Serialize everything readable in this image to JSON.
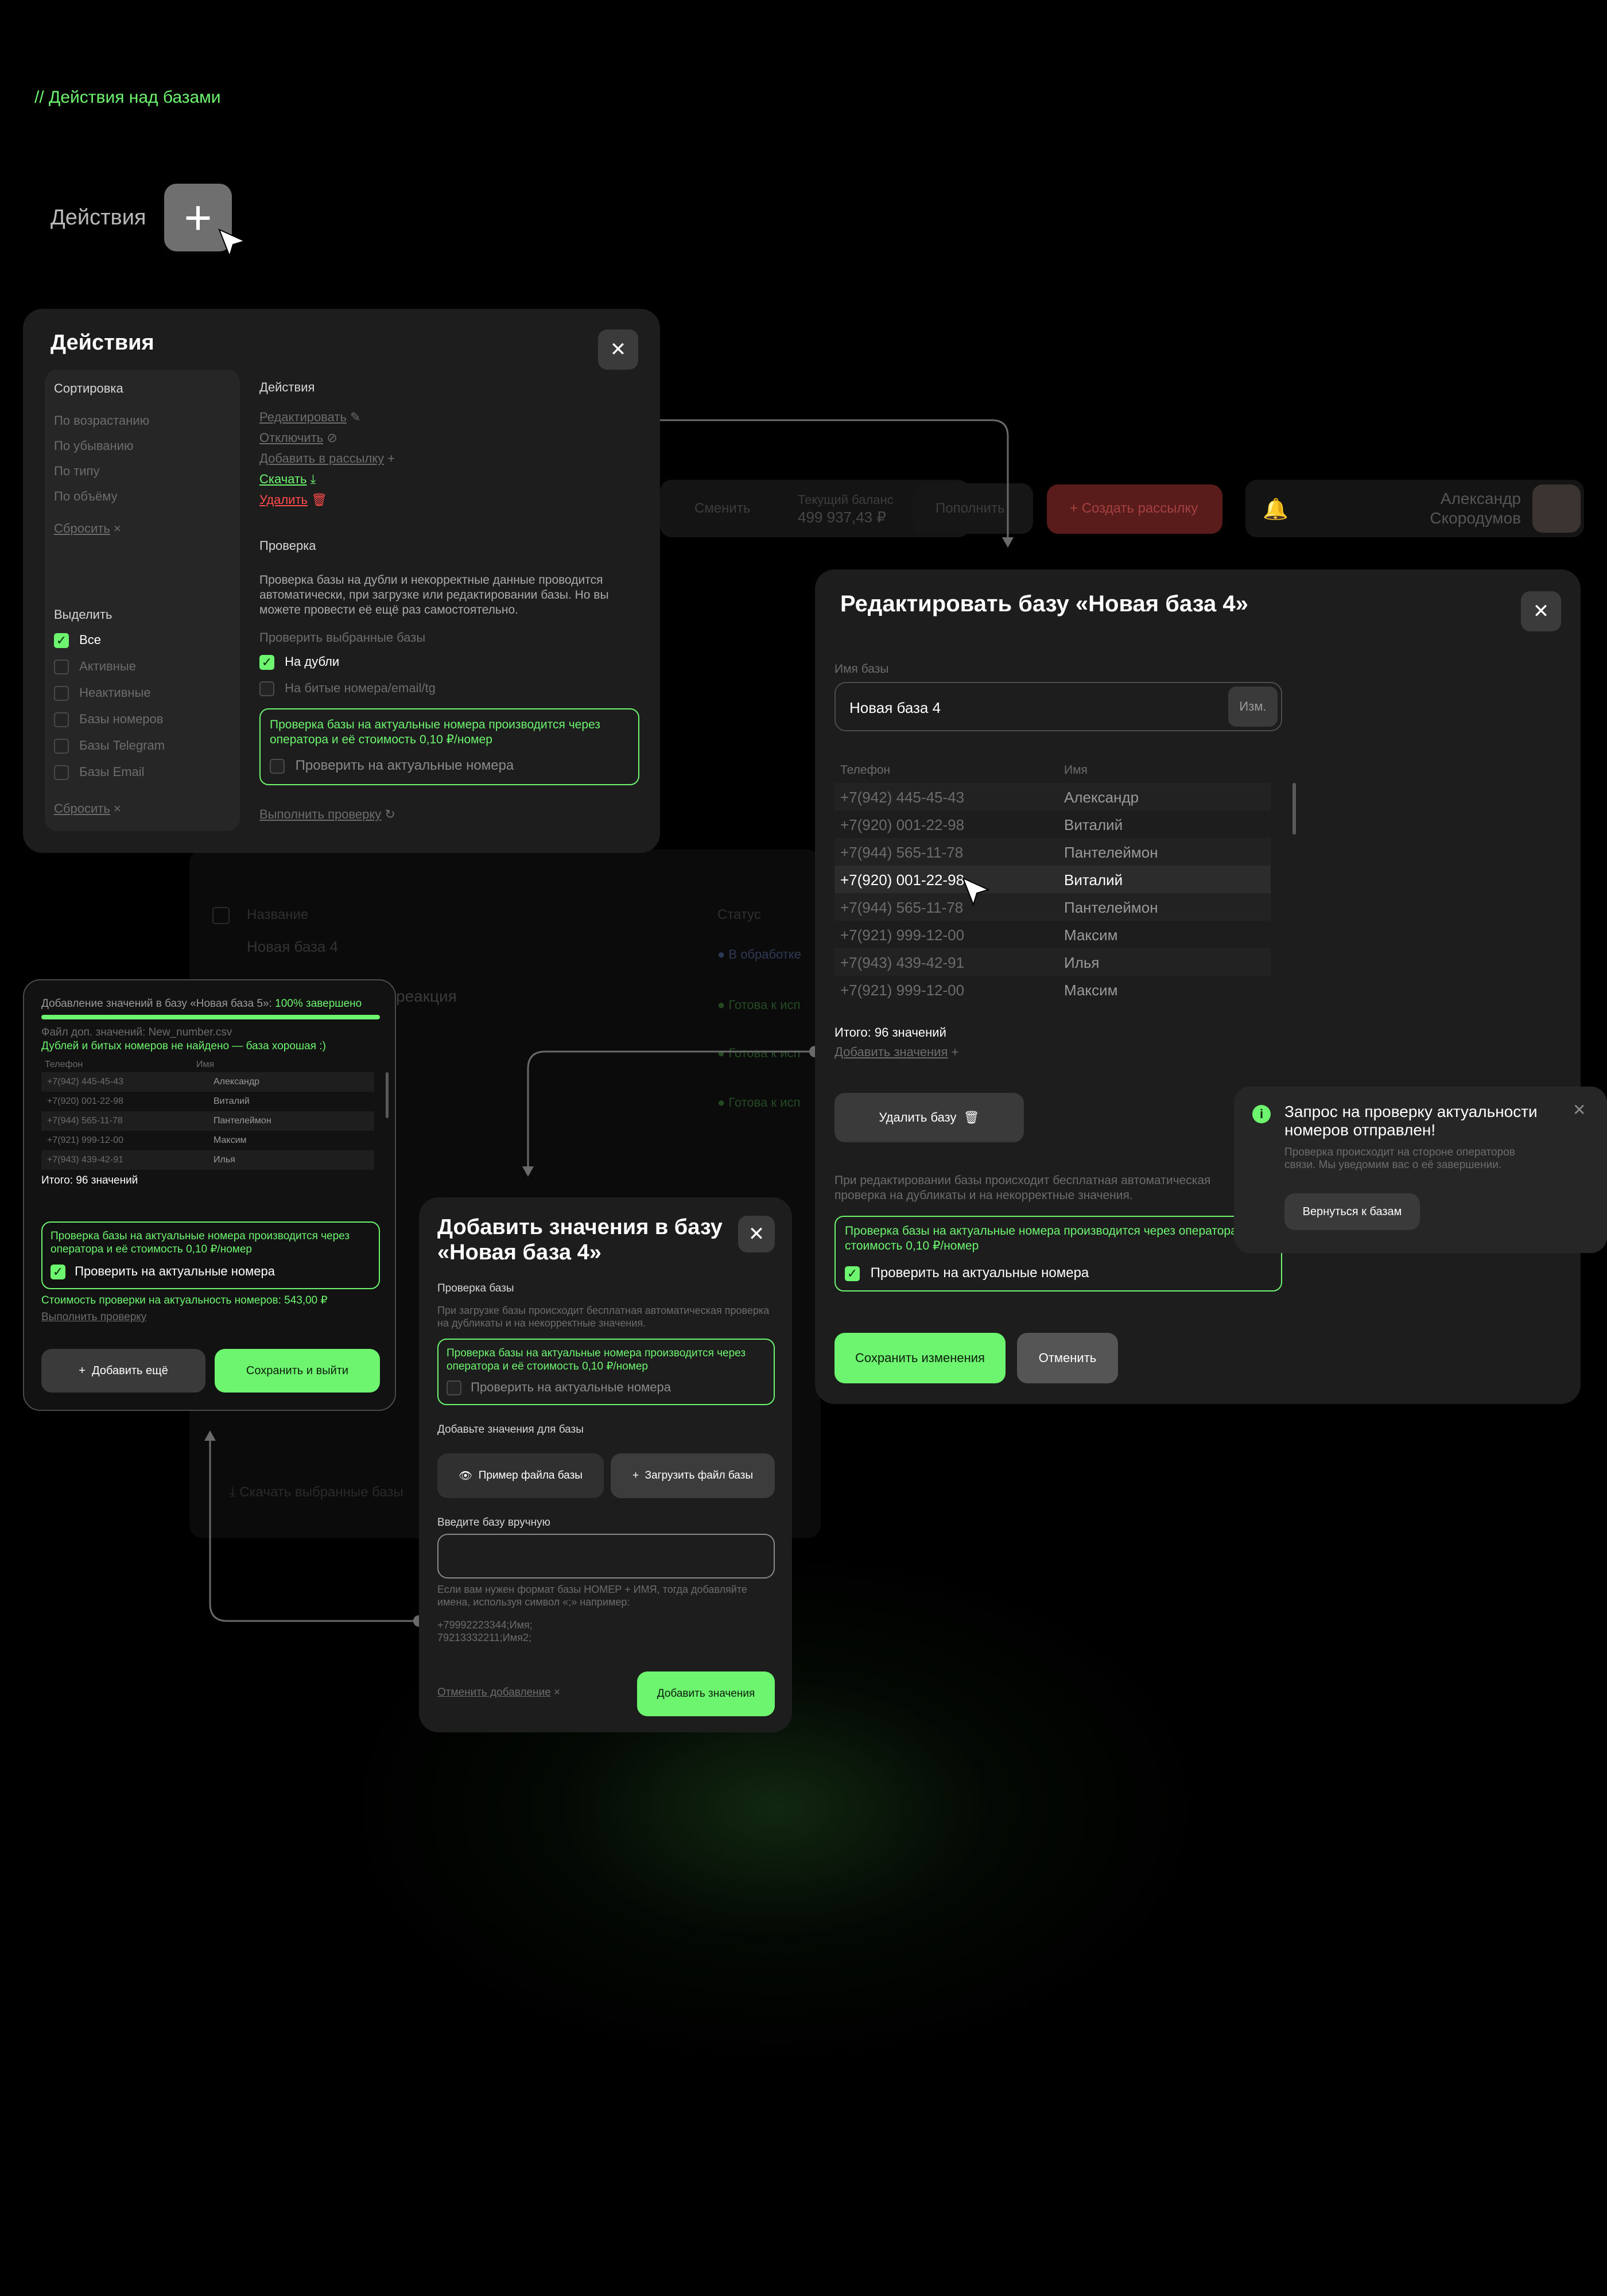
{
  "section_title": "// Действия над базами",
  "actions_label": "Действия",
  "actions_modal": {
    "title": "Действия",
    "sort": {
      "heading": "Сортировка",
      "items": [
        "По возрастанию",
        "По убыванию",
        "По типу",
        "По объёму"
      ],
      "reset": "Сбросить"
    },
    "select": {
      "heading": "Выделить",
      "items": [
        {
          "label": "Все",
          "checked": true
        },
        {
          "label": "Активные",
          "checked": false
        },
        {
          "label": "Неактивные",
          "checked": false
        },
        {
          "label": "Базы номеров",
          "checked": false
        },
        {
          "label": "Базы Telegram",
          "checked": false
        },
        {
          "label": "Базы Email",
          "checked": false
        }
      ],
      "reset": "Сбросить"
    },
    "actions": {
      "heading": "Действия",
      "edit": "Редактировать",
      "disable": "Отключить",
      "add_to_mailing": "Добавить в рассылку",
      "download": "Скачать",
      "delete": "Удалить"
    },
    "check": {
      "heading": "Проверка",
      "description": "Проверка базы на дубли и некорректные данные проводится автоматически, при загрузке или редактировании базы. Но вы можете провести её ещё раз самостоятельно.",
      "subheading": "Проверить выбранные базы",
      "options": [
        {
          "label": "На дубли",
          "checked": true
        },
        {
          "label": "На битые номера/email/tg",
          "checked": false
        }
      ],
      "green_notice": "Проверка базы на актуальные номера производится через оператора и её стоимость 0,10 ₽/номер",
      "actual_check": "Проверить на актуальные номера",
      "run": "Выполнить проверку"
    }
  },
  "bg_dashboard": {
    "change": "Сменить",
    "balance_label": "Текущий баланс",
    "balance_value": "499 937,43 ₽",
    "topup": "Пополнить",
    "create_mailing": "Создать рассылку",
    "user_first": "Александр",
    "user_last": "Скородумов",
    "col_name": "Название",
    "col_status": "Статус",
    "row_name": "Новая база 4",
    "status_processing": "В обработке",
    "reaction": "реакция",
    "status_ready": "Готова к исп",
    "status_ready2": "Готова к исп",
    "status_ready3": "Готова к исп",
    "send_selected": "Скачать выбранные базы"
  },
  "edit_modal": {
    "title": "Редактировать базу «Новая база 4»",
    "name_label": "Имя базы",
    "name_value": "Новая база 4",
    "rename_btn": "Изм.",
    "col_phone": "Телефон",
    "col_name": "Имя",
    "rows": [
      {
        "phone": "+7(942) 445-45-43",
        "name": "Александр"
      },
      {
        "phone": "+7(920) 001-22-98",
        "name": "Виталий"
      },
      {
        "phone": "+7(944) 565-11-78",
        "name": "Пантелеймон"
      },
      {
        "phone": "+7(920) 001-22-98",
        "name": "Виталий"
      },
      {
        "phone": "+7(944) 565-11-78",
        "name": "Пантелеймон"
      },
      {
        "phone": "+7(921) 999-12-00",
        "name": "Максим"
      },
      {
        "phone": "+7(943) 439-42-91",
        "name": "Илья"
      },
      {
        "phone": "+7(921) 999-12-00",
        "name": "Максим"
      }
    ],
    "total": "Итого: 96 значений",
    "add_values": "Добавить значения",
    "delete_base": "Удалить базу",
    "note": "При редактировании базы происходит бесплатная автоматическая проверка на дубликаты и на некорректные значения.",
    "green_notice": "Проверка базы на актуальные номера производится через оператора и её стоимость 0,10 ₽/номер",
    "actual_check": "Проверить на актуальные номера",
    "save": "Сохранить изменения",
    "cancel": "Отменить"
  },
  "progress_panel": {
    "title_prefix": "Добавление значений в базу «Новая база 5»:",
    "title_status": "100% завершено",
    "progress": 1.0,
    "file": "Файл доп. значений: New_number.csv",
    "result": "Дублей и битых номеров не найдено — база хорошая :)",
    "col_phone": "Телефон",
    "col_name": "Имя",
    "rows": [
      {
        "phone": "+7(942) 445-45-43",
        "name": "Александр"
      },
      {
        "phone": "+7(920) 001-22-98",
        "name": "Виталий"
      },
      {
        "phone": "+7(944) 565-11-78",
        "name": "Пантелеймон"
      },
      {
        "phone": "+7(921) 999-12-00",
        "name": "Максим"
      },
      {
        "phone": "+7(943) 439-42-91",
        "name": "Илья"
      }
    ],
    "total": "Итого: 96 значений",
    "green_notice": "Проверка базы на актуальные номера производится через оператора и её стоимость 0,10 ₽/номер",
    "actual_check": "Проверить на актуальные номера",
    "cost": "Стоимость проверки на актуальность номеров: 543,00 ₽",
    "run": "Выполнить проверку",
    "add_more": "Добавить ещё",
    "save_exit": "Сохранить и выйти"
  },
  "add_modal": {
    "title_line1": "Добавить значения в базу",
    "title_line2": "«Новая база 4»",
    "check_heading": "Проверка базы",
    "check_note": "При загрузке базы происходит бесплатная автоматическая проверка на дубликаты и на некорректные значения.",
    "green_notice": "Проверка базы на актуальные номера производится через оператора и её стоимость 0,10 ₽/номер",
    "actual_check": "Проверить на актуальные номера",
    "add_heading": "Добавьте значения для базы",
    "example_btn": "Пример файла базы",
    "upload_btn": "Загрузить файл базы",
    "manual_label": "Введите базу вручную",
    "manual_hint": "Если вам нужен формат базы НОМЕР + ИМЯ, тогда добавляйте имена, используя символ «;» например:",
    "example_line1": "+79992223344;Имя;",
    "example_line2": "79213332211;Имя2;",
    "cancel": "Отменить добавление",
    "submit": "Добавить значения"
  },
  "notify": {
    "title": "Запрос на проверку актуальности номеров отправлен!",
    "body": "Проверка происходит на стороне операторов связи. Мы уведомим вас о её завершении.",
    "back": "Вернуться к базам"
  },
  "colors": {
    "accent": "#6df56f",
    "danger": "#ff4b4b",
    "panel": "#1d1d1d"
  }
}
